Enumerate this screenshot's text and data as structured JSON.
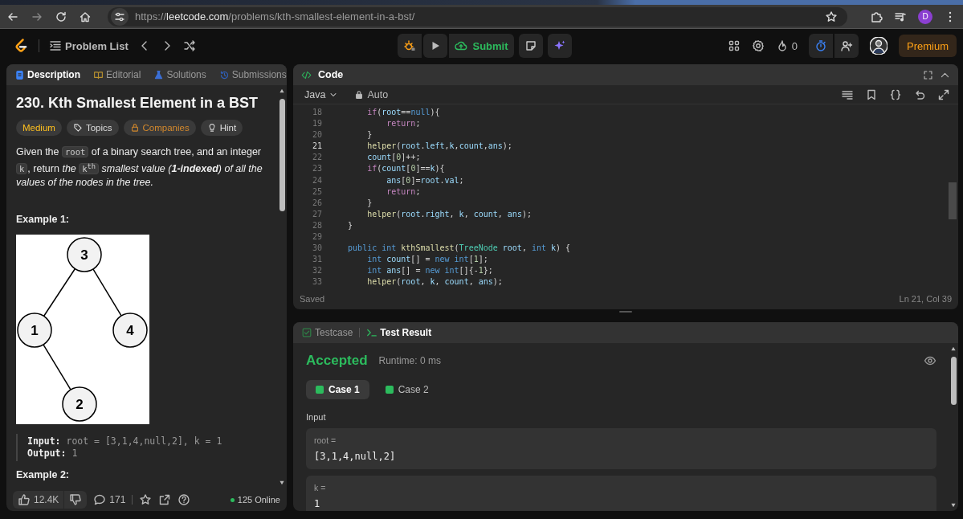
{
  "browser": {
    "url": {
      "scheme": "https://",
      "host": "leetcode.com",
      "path": "/problems/kth-smallest-element-in-a-bst/"
    },
    "profile_initial": "D"
  },
  "nav": {
    "problem_list": "Problem List",
    "submit": "Submit",
    "streak": "0",
    "premium": "Premium"
  },
  "description_panel": {
    "tabs": [
      {
        "label": "Description",
        "selected": true,
        "color": "#3b82f6"
      },
      {
        "label": "Editorial",
        "selected": false,
        "color": "#b8912f"
      },
      {
        "label": "Solutions",
        "selected": false,
        "color": "#3b6fd6"
      },
      {
        "label": "Submissions",
        "selected": false,
        "color": "#2f5fb8"
      }
    ],
    "title": "230. Kth Smallest Element in a BST",
    "tags": [
      {
        "label": "Medium",
        "kind": "difficulty"
      },
      {
        "label": "Topics",
        "kind": "topics"
      },
      {
        "label": "Companies",
        "kind": "companies"
      },
      {
        "label": "Hint",
        "kind": "hint"
      }
    ],
    "statement": [
      {
        "text": "Given the ",
        "kind": "plain"
      },
      {
        "text": "root",
        "kind": "code"
      },
      {
        "text": " of a binary search tree, and an integer ",
        "kind": "plain"
      },
      {
        "text": "k",
        "kind": "code"
      },
      {
        "text": ", return ",
        "kind": "plain"
      },
      {
        "text": "the ",
        "kind": "italic"
      },
      {
        "text": "k$^{th}$",
        "kind": "code"
      },
      {
        "text": " smallest value (",
        "kind": "italic"
      },
      {
        "text": "1-indexed",
        "kind": "bold_italic"
      },
      {
        "text": ") of all the values of the nodes in the tree.",
        "kind": "italic"
      }
    ],
    "examples": [
      {
        "heading": "Example 1:",
        "tree": {
          "nodes": [
            {
              "label": "3",
              "children": [
                {
                  "label": "1",
                  "children": [
                    {
                      "label": "2"
                    }
                  ]
                },
                {
                  "label": "4"
                }
              ]
            }
          ]
        },
        "lines": [
          "**Input:** root = [3,1,4,null,2], k = 1",
          "**Output:** 1"
        ]
      },
      {
        "heading": "Example 2:"
      }
    ],
    "footer": {
      "likes": "12.4K",
      "comments": "171",
      "online": "125 Online"
    }
  },
  "code_panel": {
    "title": "Code",
    "language": "Java",
    "mode": "Auto",
    "lines": [
      {
        "number": "18",
        "current": false,
        "tokens": [
          {
            "text": "        if",
            "kind": "ctl"
          },
          {
            "text": "(",
            "kind": "op"
          },
          {
            "text": "root",
            "kind": "var"
          },
          {
            "text": "==",
            "kind": "op"
          },
          {
            "text": "null",
            "kind": "kw"
          },
          {
            "text": "){",
            "kind": "op"
          }
        ]
      },
      {
        "number": "19",
        "current": false,
        "tokens": [
          {
            "text": "            return",
            "kind": "ctl"
          },
          {
            "text": ";",
            "kind": "op"
          }
        ]
      },
      {
        "number": "20",
        "current": false,
        "tokens": [
          {
            "text": "        }",
            "kind": "op"
          }
        ]
      },
      {
        "number": "21",
        "current": true,
        "tokens": [
          {
            "text": "        helper",
            "kind": "fn"
          },
          {
            "text": "(",
            "kind": "op"
          },
          {
            "text": "root",
            "kind": "var"
          },
          {
            "text": ".",
            "kind": "op"
          },
          {
            "text": "left",
            "kind": "var"
          },
          {
            "text": ",",
            "kind": "op"
          },
          {
            "text": "k",
            "kind": "var"
          },
          {
            "text": ",",
            "kind": "op"
          },
          {
            "text": "count",
            "kind": "var"
          },
          {
            "text": ",",
            "kind": "op"
          },
          {
            "text": "ans",
            "kind": "var"
          },
          {
            "text": ");",
            "kind": "op"
          }
        ]
      },
      {
        "number": "22",
        "current": false,
        "tokens": [
          {
            "text": "        count",
            "kind": "var"
          },
          {
            "text": "[",
            "kind": "op"
          },
          {
            "text": "0",
            "kind": "num"
          },
          {
            "text": "]++;",
            "kind": "op"
          }
        ]
      },
      {
        "number": "23",
        "current": false,
        "tokens": [
          {
            "text": "        if",
            "kind": "ctl"
          },
          {
            "text": "(",
            "kind": "op"
          },
          {
            "text": "count",
            "kind": "var"
          },
          {
            "text": "[",
            "kind": "op"
          },
          {
            "text": "0",
            "kind": "num"
          },
          {
            "text": "]==",
            "kind": "op"
          },
          {
            "text": "k",
            "kind": "var"
          },
          {
            "text": "){",
            "kind": "op"
          }
        ]
      },
      {
        "number": "24",
        "current": false,
        "tokens": [
          {
            "text": "            ans",
            "kind": "var"
          },
          {
            "text": "[",
            "kind": "op"
          },
          {
            "text": "0",
            "kind": "num"
          },
          {
            "text": "]=",
            "kind": "op"
          },
          {
            "text": "root",
            "kind": "var"
          },
          {
            "text": ".",
            "kind": "op"
          },
          {
            "text": "val",
            "kind": "var"
          },
          {
            "text": ";",
            "kind": "op"
          }
        ]
      },
      {
        "number": "25",
        "current": false,
        "tokens": [
          {
            "text": "            return",
            "kind": "ctl"
          },
          {
            "text": ";",
            "kind": "op"
          }
        ]
      },
      {
        "number": "26",
        "current": false,
        "tokens": [
          {
            "text": "        }",
            "kind": "op"
          }
        ]
      },
      {
        "number": "27",
        "current": false,
        "tokens": [
          {
            "text": "        helper",
            "kind": "fn"
          },
          {
            "text": "(",
            "kind": "op"
          },
          {
            "text": "root",
            "kind": "var"
          },
          {
            "text": ".",
            "kind": "op"
          },
          {
            "text": "right",
            "kind": "var"
          },
          {
            "text": ", ",
            "kind": "op"
          },
          {
            "text": "k",
            "kind": "var"
          },
          {
            "text": ", ",
            "kind": "op"
          },
          {
            "text": "count",
            "kind": "var"
          },
          {
            "text": ", ",
            "kind": "op"
          },
          {
            "text": "ans",
            "kind": "var"
          },
          {
            "text": ");",
            "kind": "op"
          }
        ]
      },
      {
        "number": "28",
        "current": false,
        "tokens": [
          {
            "text": "    }",
            "kind": "op"
          }
        ]
      },
      {
        "number": "29",
        "current": false
      },
      {
        "number": "30",
        "current": false,
        "tokens": [
          {
            "text": "    public",
            "kind": "kw"
          },
          {
            "text": " int",
            "kind": "kw"
          },
          {
            "text": " kthSmallest",
            "kind": "fn"
          },
          {
            "text": "(",
            "kind": "op"
          },
          {
            "text": "TreeNode",
            "kind": "type"
          },
          {
            "text": " root",
            "kind": "var"
          },
          {
            "text": ", ",
            "kind": "op"
          },
          {
            "text": "int",
            "kind": "kw"
          },
          {
            "text": " k",
            "kind": "var"
          },
          {
            "text": ") {",
            "kind": "op"
          }
        ]
      },
      {
        "number": "31",
        "current": false,
        "tokens": [
          {
            "text": "        int",
            "kind": "kw"
          },
          {
            "text": " count",
            "kind": "var"
          },
          {
            "text": "[] = ",
            "kind": "op"
          },
          {
            "text": "new",
            "kind": "kw"
          },
          {
            "text": " int",
            "kind": "kw"
          },
          {
            "text": "[",
            "kind": "op"
          },
          {
            "text": "1",
            "kind": "num"
          },
          {
            "text": "];",
            "kind": "op"
          }
        ]
      },
      {
        "number": "32",
        "current": false,
        "tokens": [
          {
            "text": "        int",
            "kind": "kw"
          },
          {
            "text": " ans",
            "kind": "var"
          },
          {
            "text": "[] = ",
            "kind": "op"
          },
          {
            "text": "new",
            "kind": "kw"
          },
          {
            "text": " int",
            "kind": "kw"
          },
          {
            "text": "[]{-",
            "kind": "op"
          },
          {
            "text": "1",
            "kind": "num"
          },
          {
            "text": "};",
            "kind": "op"
          }
        ]
      },
      {
        "number": "33",
        "current": false,
        "tokens": [
          {
            "text": "        helper",
            "kind": "fn"
          },
          {
            "text": "(",
            "kind": "op"
          },
          {
            "text": "root",
            "kind": "var"
          },
          {
            "text": ", ",
            "kind": "op"
          },
          {
            "text": "k",
            "kind": "var"
          },
          {
            "text": ", ",
            "kind": "op"
          },
          {
            "text": "count",
            "kind": "var"
          },
          {
            "text": ", ",
            "kind": "op"
          },
          {
            "text": "ans",
            "kind": "var"
          },
          {
            "text": ");",
            "kind": "op"
          }
        ]
      }
    ],
    "status": "Saved",
    "cursor": "Ln 21, Col 39"
  },
  "test_panel": {
    "tabs": [
      {
        "label": "Testcase",
        "selected": false
      },
      {
        "label": "Test Result",
        "selected": true
      }
    ],
    "verdict": "Accepted",
    "runtime": "Runtime: 0 ms",
    "cases": [
      {
        "label": "Case 1",
        "selected": true,
        "passed": true
      },
      {
        "label": "Case 2",
        "selected": false,
        "passed": true
      }
    ],
    "input_heading": "Input",
    "inputs": [
      {
        "name": "root =",
        "value": "[3,1,4,null,2]"
      },
      {
        "name": "k =",
        "value": "1"
      }
    ]
  }
}
